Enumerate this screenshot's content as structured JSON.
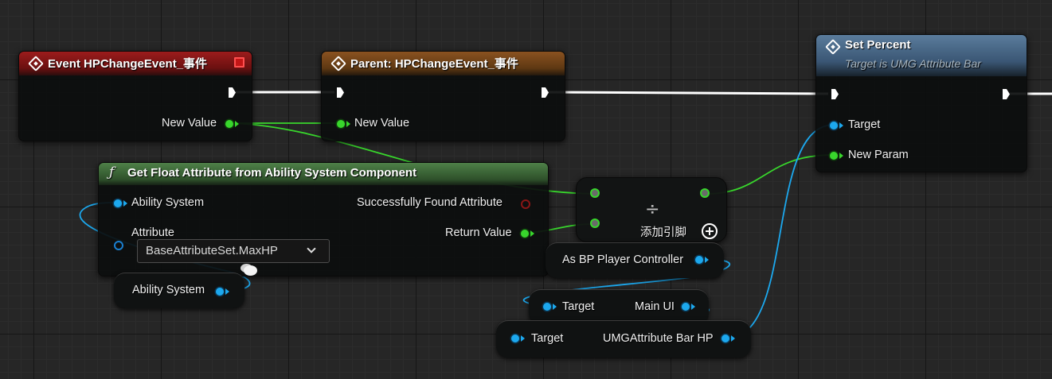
{
  "colors": {
    "event_header": "#8a1414",
    "parent_header": "#7a4616",
    "function_header": "#3e6e3a",
    "target_header": "#4e6e8e",
    "float_pin": "#38d62c",
    "object_pin": "#1ca8ee",
    "exec_wire": "#ffffff"
  },
  "event_node": {
    "title": "Event HPChangeEvent_事件",
    "icon": "diamond-icon",
    "output_pin": "New Value"
  },
  "parent_node": {
    "title": "Parent: HPChangeEvent_事件",
    "icon": "diamond-icon",
    "input_pin": "New Value"
  },
  "get_float_node": {
    "title": "Get Float Attribute from Ability System Component",
    "icon": "function-icon",
    "input_ability_system": "Ability System",
    "input_attribute": "Attribute",
    "attribute_value": "BaseAttributeSet.MaxHP",
    "output_found": "Successfully Found Attribute",
    "output_return": "Return Value"
  },
  "set_percent_node": {
    "title": "Set Percent",
    "subtitle": "Target is UMG Attribute Bar",
    "icon": "diamond-icon",
    "input_target": "Target",
    "input_new_param": "New Param"
  },
  "divide_node": {
    "symbol": "÷",
    "add_pin_label": "添加引脚"
  },
  "ability_system_var": {
    "label": "Ability System"
  },
  "cast_node": {
    "label": "As BP Player Controller"
  },
  "main_ui_node": {
    "input": "Target",
    "output": "Main UI"
  },
  "umg_bar_node": {
    "input": "Target",
    "output": "UMGAttribute Bar HP"
  }
}
